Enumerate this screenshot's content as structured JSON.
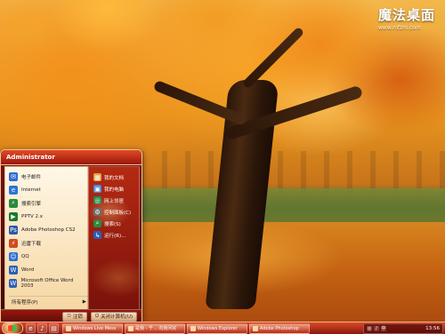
{
  "watermark": {
    "name_cn": "魔法桌面",
    "url": "www.mfzm.com"
  },
  "start_menu": {
    "user": "Administrator",
    "programs": [
      {
        "label": "电子邮件",
        "icon": "mail-icon",
        "color": "#2d6bd6"
      },
      {
        "label": "Internet",
        "icon": "ie-icon",
        "color": "#2b75d8"
      },
      {
        "label": "搜索引擎",
        "icon": "search-icon",
        "color": "#2a8a3c"
      },
      {
        "label": "PPTV 2.x",
        "icon": "pptv-icon",
        "color": "#1a7a2c"
      },
      {
        "label": "Adobe Photoshop CS2",
        "icon": "photoshop-icon",
        "color": "#2b5aa8"
      },
      {
        "label": "迅雷下载",
        "icon": "thunder-icon",
        "color": "#d14a1f"
      },
      {
        "label": "QQ",
        "icon": "qq-icon",
        "color": "#2a6fd6"
      },
      {
        "label": "Word",
        "icon": "word-icon",
        "color": "#2b5fb8"
      },
      {
        "label": "Microsoft Office Word 2003",
        "icon": "word-icon",
        "color": "#2b5fb8"
      }
    ],
    "all_programs_label": "所有程序(P)",
    "places": [
      {
        "label": "我的文档",
        "icon": "documents-icon"
      },
      {
        "label": "我的电脑",
        "icon": "computer-icon"
      },
      {
        "label": "网上邻居",
        "icon": "network-icon"
      },
      {
        "label": "控制面板(C)",
        "icon": "control-panel-icon"
      },
      {
        "label": "搜索(S)",
        "icon": "search-icon"
      },
      {
        "label": "运行(R)...",
        "icon": "run-icon"
      }
    ],
    "bottom": {
      "logoff_label": "注销",
      "shutdown_label": "关闭计算机(U)"
    }
  },
  "taskbar": {
    "items": [
      {
        "label": "Windows Live Mess",
        "icon": "messenger-icon"
      },
      {
        "label": "是我 - 千... 向我问好",
        "icon": "chat-icon"
      },
      {
        "label": "Windows Explorer",
        "icon": "folder-icon"
      },
      {
        "label": "Adobe Photoshop",
        "icon": "photoshop-icon"
      }
    ],
    "tray": {
      "time": "13:56"
    }
  }
}
